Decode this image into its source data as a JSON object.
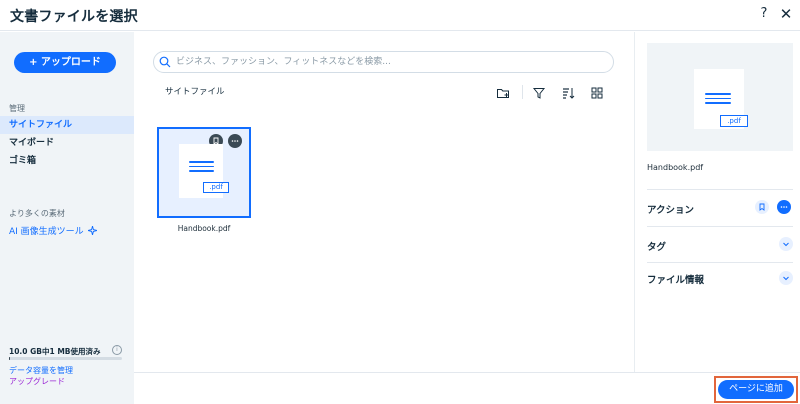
{
  "header": {
    "title": "文書ファイルを選択",
    "help_label": "?",
    "close_label": "✕"
  },
  "sidebar": {
    "upload_label": "+ アップロード",
    "manage_section": "管理",
    "items": [
      {
        "label": "サイトファイル",
        "active": true
      },
      {
        "label": "マイボード",
        "active": false
      },
      {
        "label": "ゴミ箱",
        "active": false
      }
    ],
    "more_section": "より多くの素材",
    "ai_tool_label": "AI 画像生成ツール",
    "storage": {
      "text": "10.0 GB中1 MB使用済み",
      "used_fraction": 0.0001
    },
    "manage_storage_label": "データ容量を管理",
    "upgrade_label": "アップグレード"
  },
  "main": {
    "search_placeholder": "ビジネス、ファッション、フィットネスなどを検索...",
    "breadcrumb": "サイトファイル",
    "toolbar_icons": [
      "new-folder-icon",
      "filter-icon",
      "sort-icon",
      "grid-view-icon"
    ],
    "files": [
      {
        "name": "Handbook.pdf",
        "tag": ".pdf",
        "selected": true
      }
    ]
  },
  "details": {
    "file_name": "Handbook.pdf",
    "preview_tag": ".pdf",
    "sections": [
      {
        "title": "アクション"
      },
      {
        "title": "タグ"
      },
      {
        "title": "ファイル情報"
      }
    ]
  },
  "footer": {
    "add_label": "ページに追加"
  },
  "colors": {
    "accent": "#116dff",
    "sidebar_bg": "#f0f4f7",
    "upgrade": "#9a27d5",
    "highlight_border": "#e2663c"
  }
}
